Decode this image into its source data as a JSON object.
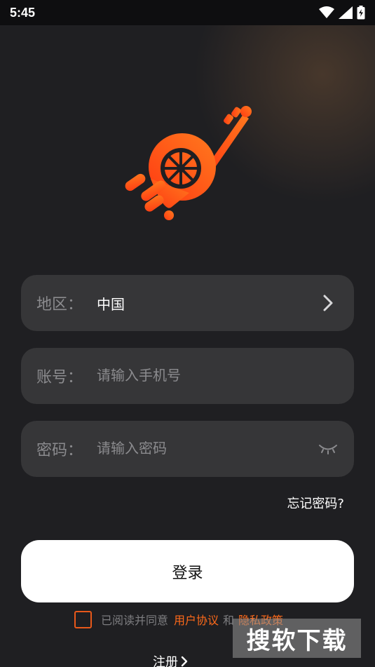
{
  "status_bar": {
    "time": "5:45"
  },
  "form": {
    "region": {
      "label": "地区：",
      "value": "中国"
    },
    "account": {
      "label": "账号：",
      "placeholder": "请输入手机号"
    },
    "password": {
      "label": "密码：",
      "placeholder": "请输入密码"
    }
  },
  "forgot_password": "忘记密码?",
  "login_button": "登录",
  "agreement": {
    "prefix": "已阅读并同意",
    "user_agreement": "用户协议",
    "and": "和",
    "privacy_policy": "隐私政策"
  },
  "register": "注册",
  "watermark": "搜软下载",
  "colors": {
    "accent": "#ff6a1a",
    "field_bg": "#363638",
    "background": "#1f1f22"
  },
  "icons": [
    "wifi-icon",
    "signal-icon",
    "battery-charging-icon",
    "chevron-right-icon",
    "eye-closed-icon"
  ]
}
